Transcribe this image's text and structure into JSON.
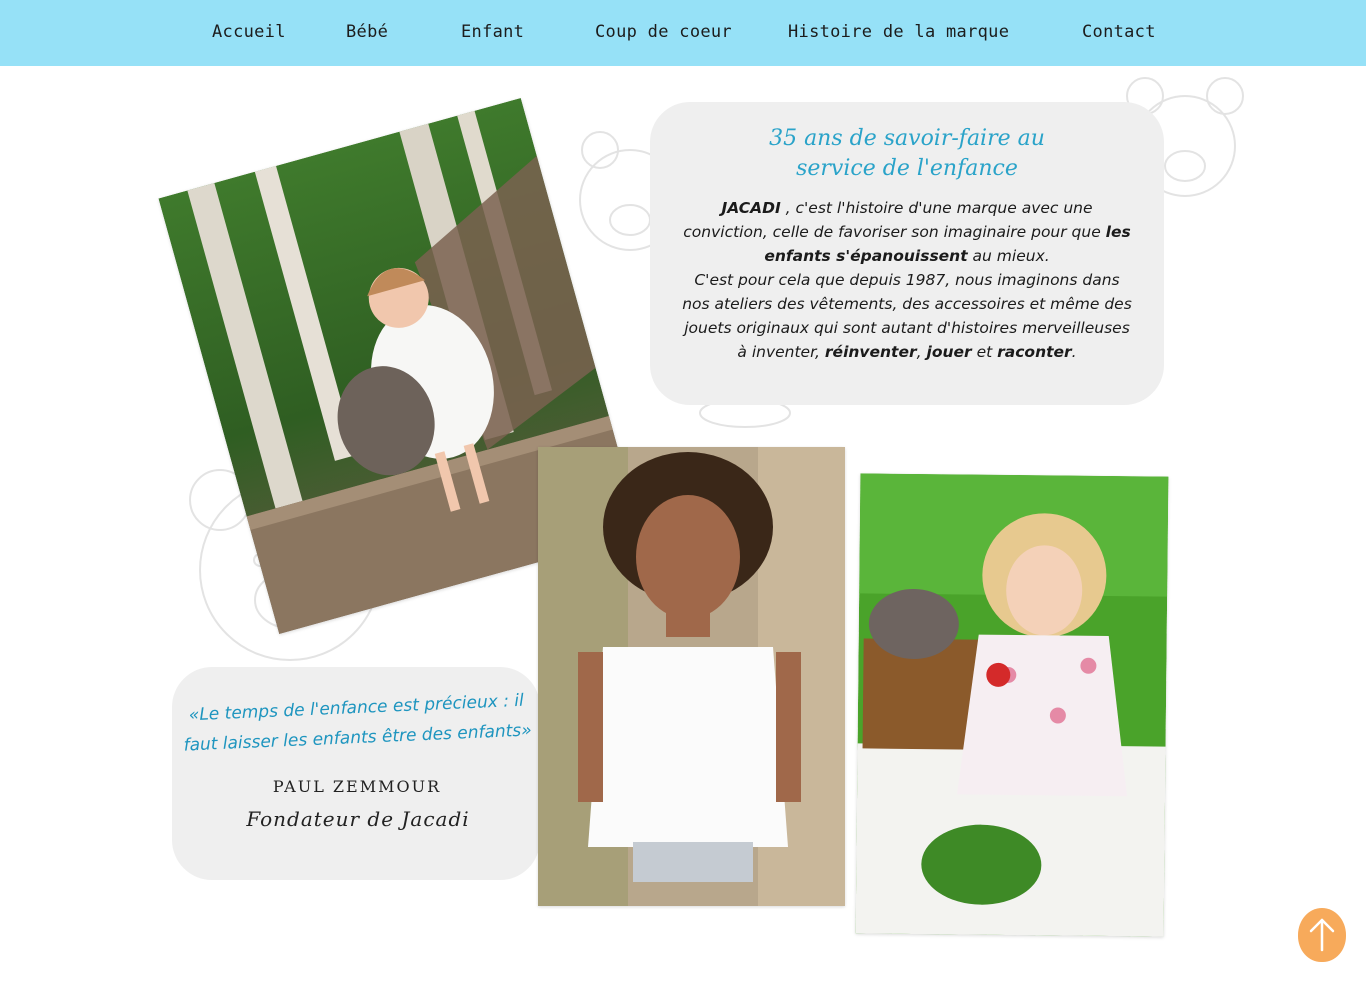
{
  "nav": {
    "items": [
      "Accueil",
      "Bébé",
      "Enfant",
      "Coup de coeur",
      "Histoire de la marque",
      "Contact"
    ],
    "background": "#96e1f7"
  },
  "intro": {
    "title_line1": "35 ans de savoir-faire au",
    "title_line2": "service de l'enfance",
    "p1_brand": "JACADI",
    "p1_text1": " , c'est l'histoire d'une marque avec une conviction, celle de favoriser son imaginaire pour que ",
    "p1_bold": "les enfants s'épanouissent",
    "p1_text2": " au mieux.",
    "p2_text1": "C'est pour cela que depuis 1987, nous imaginons dans nos ateliers des vêtements, des accessoires et même des jouets originaux qui sont autant d'histoires merveilleuses à inventer, ",
    "p2_bold1": "réinventer",
    "p2_sep": ", ",
    "p2_bold2": "jouer",
    "p2_text2": " et ",
    "p2_bold3": "raconter",
    "p2_end": ".",
    "accent_color": "#2aa3c9"
  },
  "quote": {
    "text_line1": "«Le temps de l'enfance est précieux : il",
    "text_line2": "faut laisser les enfants être des enfants»",
    "author": "PAUL ZEMMOUR",
    "role": "Fondateur de Jacadi",
    "color": "#1e95bf"
  },
  "back_to_top": {
    "icon": "arrow-up-icon",
    "color": "#f7aa5b"
  }
}
